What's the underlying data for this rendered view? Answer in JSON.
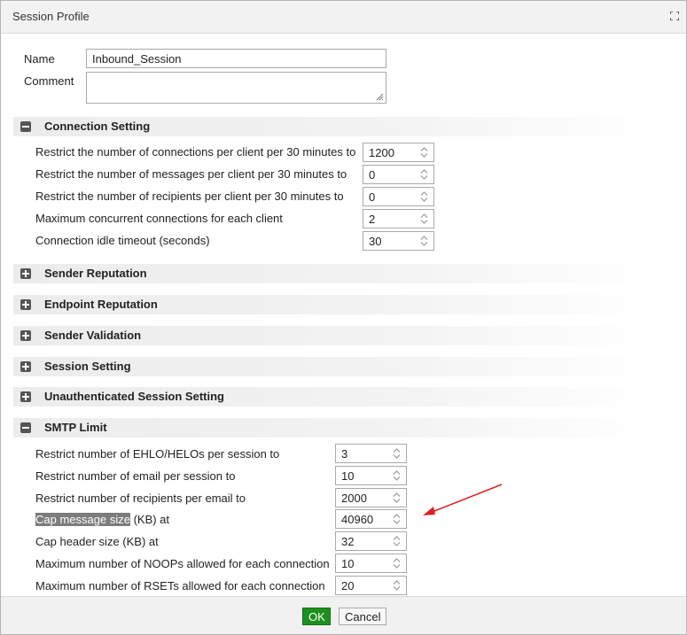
{
  "dialog": {
    "title": "Session Profile"
  },
  "form": {
    "name_label": "Name",
    "name_value": "Inbound_Session",
    "comment_label": "Comment",
    "comment_value": ""
  },
  "sections": {
    "connection": {
      "title": "Connection Setting",
      "rows": [
        {
          "label": "Restrict the number of connections per client per 30 minutes to",
          "value": "1200"
        },
        {
          "label": "Restrict the number of messages per client per 30 minutes to",
          "value": "0"
        },
        {
          "label": "Restrict the number of recipients per client per 30 minutes to",
          "value": "0"
        },
        {
          "label": "Maximum concurrent connections for each client",
          "value": "2"
        },
        {
          "label": "Connection idle timeout (seconds)",
          "value": "30"
        }
      ]
    },
    "sender_reputation": {
      "title": "Sender Reputation"
    },
    "endpoint_reputation": {
      "title": "Endpoint Reputation"
    },
    "sender_validation": {
      "title": "Sender Validation"
    },
    "session_setting": {
      "title": "Session Setting"
    },
    "unauth_session": {
      "title": "Unauthenticated Session Setting"
    },
    "smtp_limit": {
      "title": "SMTP Limit",
      "rows": [
        {
          "label": "Restrict number of EHLO/HELOs per session to",
          "value": "3"
        },
        {
          "label": "Restrict number of email per session to",
          "value": "10"
        },
        {
          "label": "Restrict number of recipients per email to",
          "value": "2000"
        },
        {
          "label_highlight": "Cap message size",
          "label_rest": " (KB) at",
          "value": "40960"
        },
        {
          "label": "Cap header size (KB) at",
          "value": "32"
        },
        {
          "label": "Maximum number of NOOPs allowed for each connection",
          "value": "10"
        },
        {
          "label": "Maximum number of RSETs allowed for each connection",
          "value": "20"
        }
      ]
    }
  },
  "footer": {
    "ok_label": "OK",
    "cancel_label": "Cancel"
  },
  "colors": {
    "ok_green": "#1d8f1d",
    "annotation_arrow": "#e02020",
    "highlight": "#7c7c7c"
  }
}
